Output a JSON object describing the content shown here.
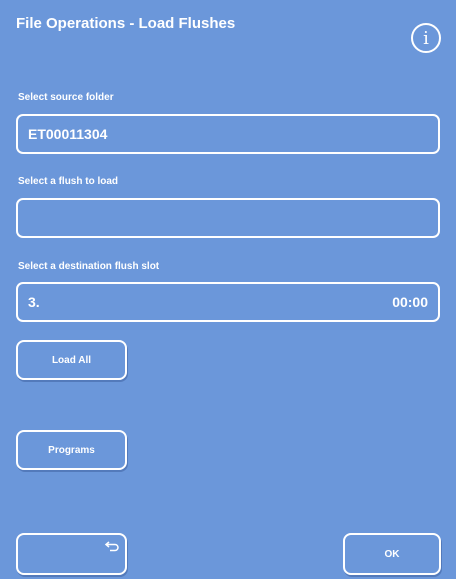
{
  "header": {
    "title": "File Operations - Load Flushes",
    "info_icon": "i"
  },
  "source": {
    "label": "Select source folder",
    "value": "ET00011304"
  },
  "flush": {
    "label": "Select a flush to load",
    "value": ""
  },
  "destination": {
    "label": "Select a destination flush slot",
    "slot": "3.",
    "time": "00:00"
  },
  "buttons": {
    "load_all": "Load All",
    "programs": "Programs",
    "ok": "OK"
  },
  "icons": {
    "info": "info-icon",
    "back": "back-arrow-icon"
  },
  "colors": {
    "panel": "#6b97da",
    "text": "#ffffff"
  }
}
